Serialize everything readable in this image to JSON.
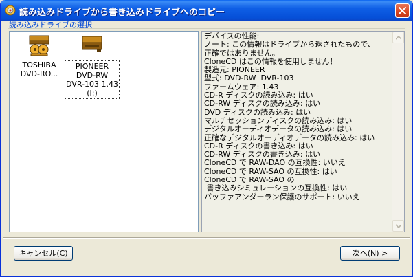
{
  "window": {
    "title": "読み込みドライブから書き込みドライブへのコピー",
    "close_label": "×"
  },
  "drives_section": {
    "label": "読み込みドライブの選択",
    "drives": [
      {
        "label": "TOSHIBA\nDVD-RO...",
        "icon": "optical-drive-icon",
        "selected": false
      },
      {
        "label": "PIONEER\nDVD-RW\nDVR-103 1.43\n(I:)",
        "icon": "optical-drive-icon",
        "selected": true
      }
    ]
  },
  "info": {
    "lines": [
      "デバイスの性能:",
      "ノート: この情報はドライブから返されたもので、",
      "正確ではありません。",
      "CloneCD はこの情報を使用しません！",
      "製造元: PIONEER",
      "型式: DVD-RW  DVR-103",
      "ファームウェア: 1.43",
      "CD-R ディスクの読み込み: はい",
      "CD-RW ディスクの読み込み: はい",
      "DVD ディスクの読み込み: はい",
      "マルチセッションディスクの読み込み: はい",
      "デジタルオーディオデータの読み込み: はい",
      "正確なデジタルオーディオデータの読み込み: はい",
      "CD-R ディスクの書き込み: はい",
      "CD-RW ディスクの書き込み: はい",
      "CloneCD で RAW-DAO の互換性: いいえ",
      "CloneCD で RAW-SAO の互換性: はい",
      "CloneCD で RAW-SAO の",
      " 書き込みシミュレーションの互換性: はい",
      "バッファアンダーラン保護のサポート: いいえ"
    ]
  },
  "buttons": {
    "cancel": "キャンセル(C)",
    "next": "次へ(N) >"
  },
  "colors": {
    "titlebar": "#0a5ae6",
    "section_label": "#0046d5",
    "close_button": "#d8451f"
  }
}
